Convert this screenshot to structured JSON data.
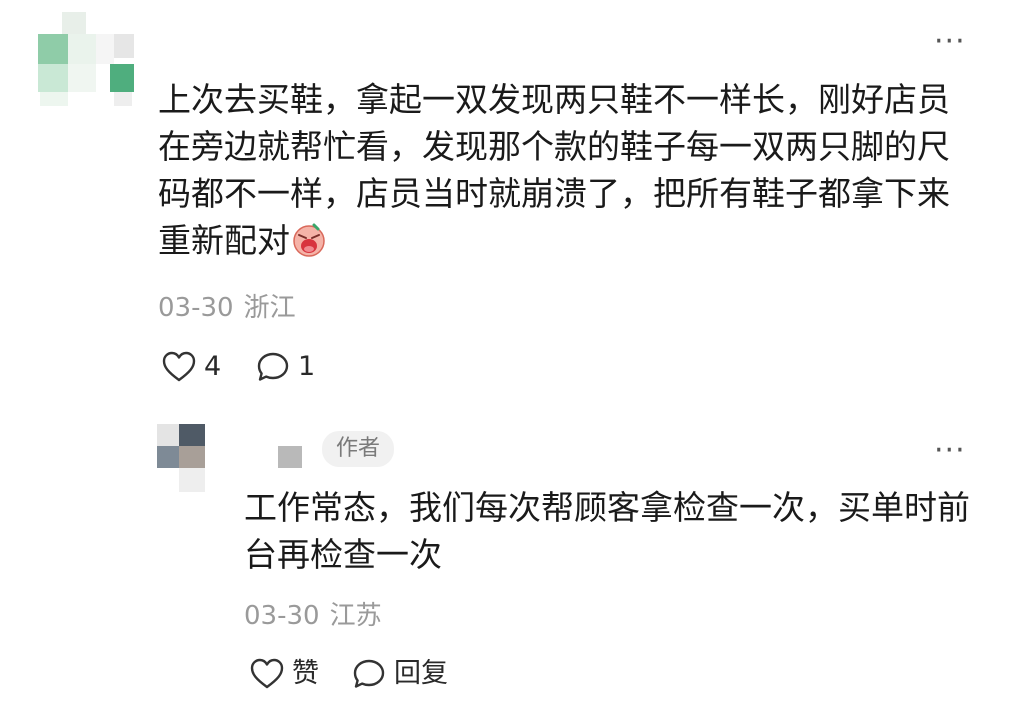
{
  "comment": {
    "text": "上次去买鞋，拿起一双发现两只鞋不一样长，刚好店员在旁边就帮忙看，发现那个款的鞋子每一双两只脚的尺码都不一样，店员当时就崩溃了，把所有鞋子都拿下来重新配对",
    "emoji": "crying-face-emoji",
    "date": "03-30",
    "location": "浙江",
    "like_count": "4",
    "reply_count": "1",
    "more_icon": "more-horizontal-icon"
  },
  "reply": {
    "author_badge": "作者",
    "text": "工作常态，我们每次帮顾客拿检查一次，买单时前台再检查一次",
    "date": "03-30",
    "location": "江苏",
    "like_label": "赞",
    "reply_label": "回复",
    "more_icon": "more-horizontal-icon"
  },
  "colors": {
    "text": "#1a1a1a",
    "meta": "#9a9a9a",
    "badge_bg": "#f1f1f1",
    "badge_text": "#7a7a7a",
    "avatar_green": "#5fb88a"
  }
}
